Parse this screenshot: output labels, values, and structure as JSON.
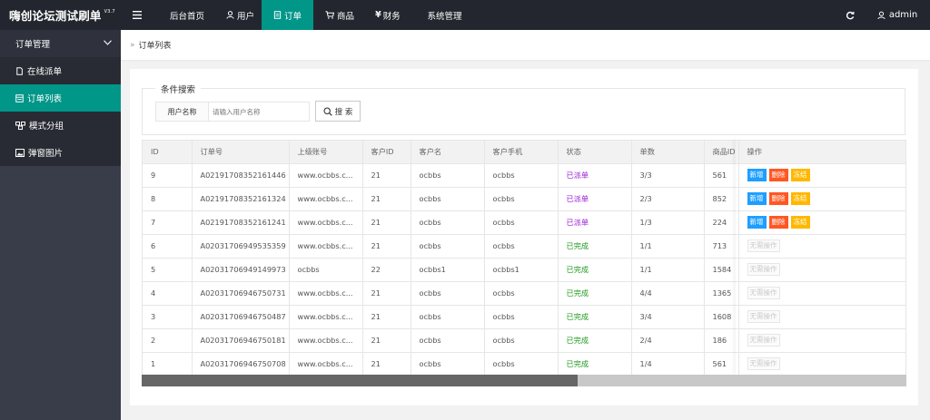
{
  "app": {
    "logo": "嗨创论坛测试刷单",
    "version": "V3.7"
  },
  "nav": [
    {
      "label": "",
      "icon": "menu-icon"
    },
    {
      "label": "后台首页",
      "icon": ""
    },
    {
      "label": "用户",
      "icon": "user-icon"
    },
    {
      "label": "订单",
      "icon": "order-icon",
      "active": true
    },
    {
      "label": "商品",
      "icon": "cart-icon"
    },
    {
      "label": "财务",
      "icon": "yen-icon"
    },
    {
      "label": "系统管理",
      "icon": ""
    }
  ],
  "topright": {
    "refresh_icon": "refresh-icon",
    "admin": "admin"
  },
  "sidebar": {
    "group": "订单管理",
    "items": [
      {
        "label": "在线派单",
        "icon": "doc-icon"
      },
      {
        "label": "订单列表",
        "icon": "list-icon",
        "active": true
      },
      {
        "label": "模式分组",
        "icon": "group-icon"
      },
      {
        "label": "弹窗图片",
        "icon": "image-icon"
      }
    ]
  },
  "breadcrumb": {
    "sep": "»",
    "text": "订单列表"
  },
  "search": {
    "legend": "条件搜索",
    "label": "用户名称",
    "placeholder": "请输入用户名称",
    "button": "搜 索"
  },
  "table": {
    "columns": [
      "ID",
      "订单号",
      "上级账号",
      "客户ID",
      "客户名",
      "客户手机",
      "状态",
      "单数",
      "商品ID",
      "操作"
    ],
    "rows": [
      {
        "id": "9",
        "order_no": "A02191708352161446",
        "parent": "www.ocbbs.c...",
        "cust_id": "21",
        "cust_name": "ocbbs",
        "phone": "ocbbs",
        "status": "已派单",
        "count": "3/3",
        "product_id": "561",
        "ops": [
          "新增",
          "删除",
          "冻结"
        ]
      },
      {
        "id": "8",
        "order_no": "A02191708352161324",
        "parent": "www.ocbbs.c...",
        "cust_id": "21",
        "cust_name": "ocbbs",
        "phone": "ocbbs",
        "status": "已派单",
        "count": "2/3",
        "product_id": "852",
        "ops": [
          "新增",
          "删除",
          "冻结"
        ]
      },
      {
        "id": "7",
        "order_no": "A02191708352161241",
        "parent": "www.ocbbs.c...",
        "cust_id": "21",
        "cust_name": "ocbbs",
        "phone": "ocbbs",
        "status": "已派单",
        "count": "1/3",
        "product_id": "224",
        "ops": [
          "新增",
          "删除",
          "冻结"
        ]
      },
      {
        "id": "6",
        "order_no": "A02031706949535359",
        "parent": "www.ocbbs.c...",
        "cust_id": "21",
        "cust_name": "ocbbs",
        "phone": "ocbbs",
        "status": "已完成",
        "count": "1/1",
        "product_id": "713",
        "ops": [
          "无需操作"
        ]
      },
      {
        "id": "5",
        "order_no": "A02031706949149973",
        "parent": "ocbbs",
        "cust_id": "22",
        "cust_name": "ocbbs1",
        "phone": "ocbbs1",
        "status": "已完成",
        "count": "1/1",
        "product_id": "1584",
        "ops": [
          "无需操作"
        ]
      },
      {
        "id": "4",
        "order_no": "A02031706946750731",
        "parent": "www.ocbbs.c...",
        "cust_id": "21",
        "cust_name": "ocbbs",
        "phone": "ocbbs",
        "status": "已完成",
        "count": "4/4",
        "product_id": "1365",
        "ops": [
          "无需操作"
        ]
      },
      {
        "id": "3",
        "order_no": "A02031706946750487",
        "parent": "www.ocbbs.c...",
        "cust_id": "21",
        "cust_name": "ocbbs",
        "phone": "ocbbs",
        "status": "已完成",
        "count": "3/4",
        "product_id": "1608",
        "ops": [
          "无需操作"
        ]
      },
      {
        "id": "2",
        "order_no": "A02031706946750181",
        "parent": "www.ocbbs.c...",
        "cust_id": "21",
        "cust_name": "ocbbs",
        "phone": "ocbbs",
        "status": "已完成",
        "count": "2/4",
        "product_id": "186",
        "ops": [
          "无需操作"
        ]
      },
      {
        "id": "1",
        "order_no": "A02031706946750708",
        "parent": "www.ocbbs.c...",
        "cust_id": "21",
        "cust_name": "ocbbs",
        "phone": "ocbbs",
        "status": "已完成",
        "count": "1/4",
        "product_id": "561",
        "ops": [
          "无需操作"
        ]
      }
    ]
  },
  "colors": {
    "accent": "#009688",
    "header": "#23262e",
    "sidebar": "#393d49",
    "status_dispatched": "#9b1ed6",
    "status_done": "#219a1f",
    "btn_add": "#1e9fff",
    "btn_delete": "#ff5722",
    "btn_freeze": "#ffb800"
  },
  "scroll": {
    "horizontal_fraction": 0.57
  }
}
